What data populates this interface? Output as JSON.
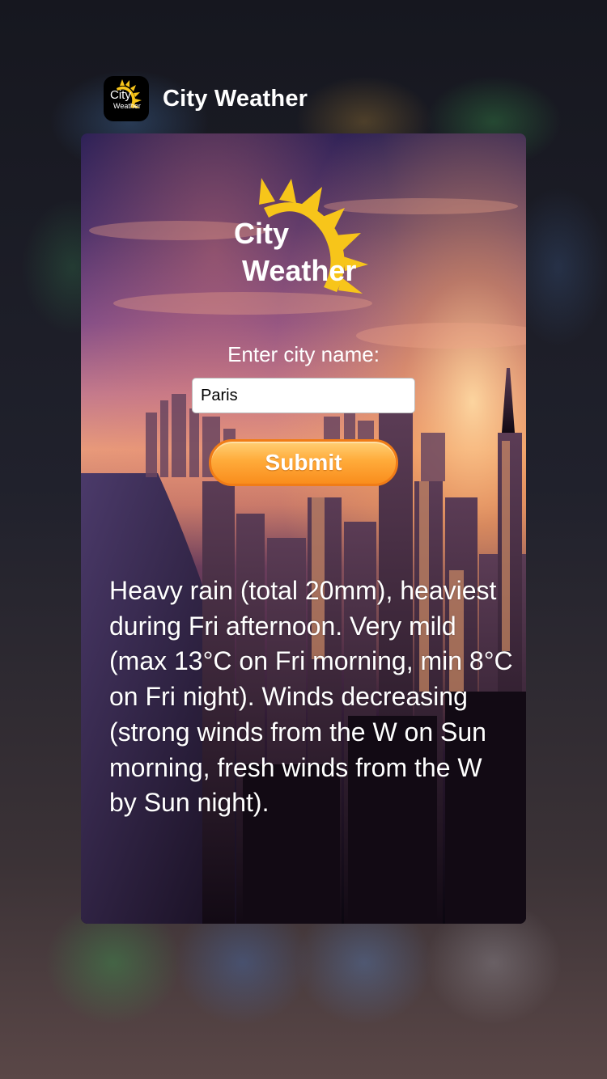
{
  "app_switcher": {
    "app_name": "City Weather",
    "icon": {
      "name": "city-weather-app-icon",
      "line1": "City",
      "line2": "Weather"
    }
  },
  "app": {
    "logo": {
      "line1": "City",
      "line2": "Weather"
    },
    "city_label": "Enter city name:",
    "city_input_value": "Paris",
    "submit_label": "Submit",
    "forecast_text": "Heavy rain (total 20mm), heaviest during Fri afternoon. Very mild (max 13°C on Fri morning, min 8°C on Fri night). Winds decreasing (strong winds from the W on Sun morning, fresh winds from the W by Sun night)."
  },
  "colors": {
    "sun_yellow": "#f7c51a",
    "button_orange": "#f98d1d",
    "sky_purple": "#3c2a6b",
    "sunset_orange": "#e89a5a"
  }
}
